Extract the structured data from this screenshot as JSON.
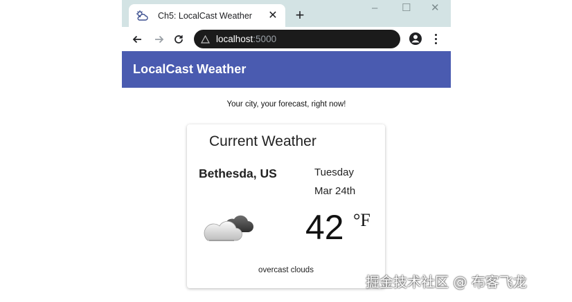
{
  "browser": {
    "tab": {
      "title": "Ch5: LocalCast Weather",
      "favicon": "cloud-sun-icon",
      "close_icon": "close-icon"
    },
    "new_tab_icon": "plus-icon",
    "window_controls": {
      "minimize": "–",
      "maximize": "☐",
      "close": "✕"
    },
    "address": {
      "host": "localhost",
      "port": ":5000",
      "security_icon": "warning-triangle-icon"
    },
    "nav_icons": [
      "back-arrow-icon",
      "forward-arrow-icon",
      "reload-icon"
    ],
    "profile_icon": "account-circle-icon",
    "menu_icon": "more-vert-icon"
  },
  "app": {
    "title": "LocalCast Weather",
    "tagline": "Your city, your forecast, right now!",
    "accent_color": "#4a5bb0"
  },
  "weather": {
    "heading": "Current Weather",
    "city": "Bethesda, US",
    "day": "Tuesday",
    "date": "Mar 24th",
    "temperature": "42",
    "unit": "°F",
    "description": "overcast clouds",
    "icon": "overcast-clouds-icon"
  },
  "watermark": "掘金技术社区 @ 布客飞龙"
}
